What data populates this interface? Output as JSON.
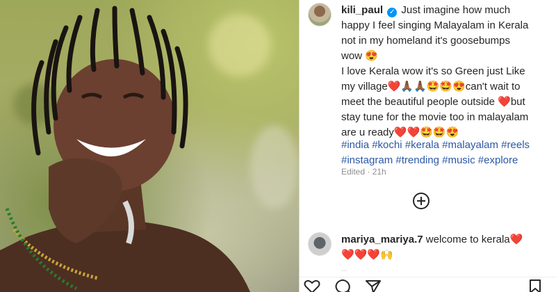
{
  "post": {
    "username": "kili_paul",
    "caption_lines": [
      "Just imagine how much",
      "happy I feel singing Malayalam in Kerala",
      "not in my homeland it's goosebumps",
      "wow 😍",
      "I love Kerala wow it's so Green just Like",
      "my village❤️🙏🏾🙏🏾🤩🤩😍can't wait to",
      "meet the beautiful people outside ❤️but",
      "stay tune for the movie too in malayalam",
      "are u ready❤️❤️🤩🤩😍"
    ],
    "hashtags_line1": [
      "#india",
      "#kochi",
      "#kerala",
      "#malayalam",
      "#reels"
    ],
    "hashtags_line2": [
      "#instagram",
      "#trending",
      "#music",
      "#explore"
    ],
    "meta": "Edited · 21h"
  },
  "comments": [
    {
      "username": "mariya_mariya.7",
      "text": "welcome to kerala❤️",
      "text_line2": "❤️❤️❤️🙌"
    }
  ],
  "next_comment_preview": "...",
  "icons": {
    "like": "heart-icon",
    "comment": "comment-icon",
    "share": "share-icon",
    "save": "bookmark-icon",
    "load_more": "plus-circle-icon",
    "verified": "verified-badge-icon"
  },
  "colors": {
    "hashtag": "#2c58a5",
    "verified": "#0095f6",
    "meta": "#8e8e8e"
  }
}
